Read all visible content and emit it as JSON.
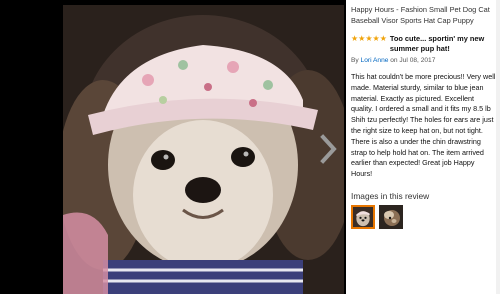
{
  "product": {
    "title": "Happy Hours - Fashion Small Pet Dog Cat Baseball Visor Sports Hat Cap Puppy"
  },
  "review": {
    "rating": 5,
    "rating_max": 5,
    "title": "Too cute... sportin' my new summer pup hat!",
    "by_prefix": "By",
    "author": "Lori Anne",
    "date": "on Jul 08, 2017",
    "body": "This hat couldn't be more precious!! Very well made. Material sturdy, similar to blue jean material. Exactly as pictured. Excellent quality. I ordered a small and it fits my 8.5 lb Shih tzu perfectly! The holes for ears are just the right size to keep hat on, but not tight. There is also a under the chin drawstring strap to help hold hat on. The item arrived earlier than expected! Great job Happy Hours!"
  },
  "images_section": {
    "heading": "Images in this review",
    "thumbnails": [
      {
        "name": "dog-with-hat-thumbnail",
        "selected": true
      },
      {
        "name": "dog-side-thumbnail",
        "selected": false
      }
    ]
  },
  "viewer": {
    "next_icon": "chevron-right-icon"
  },
  "colors": {
    "star": "#f0a30a",
    "author_link": "#0066c0",
    "selected_thumb_border": "#e77600"
  }
}
